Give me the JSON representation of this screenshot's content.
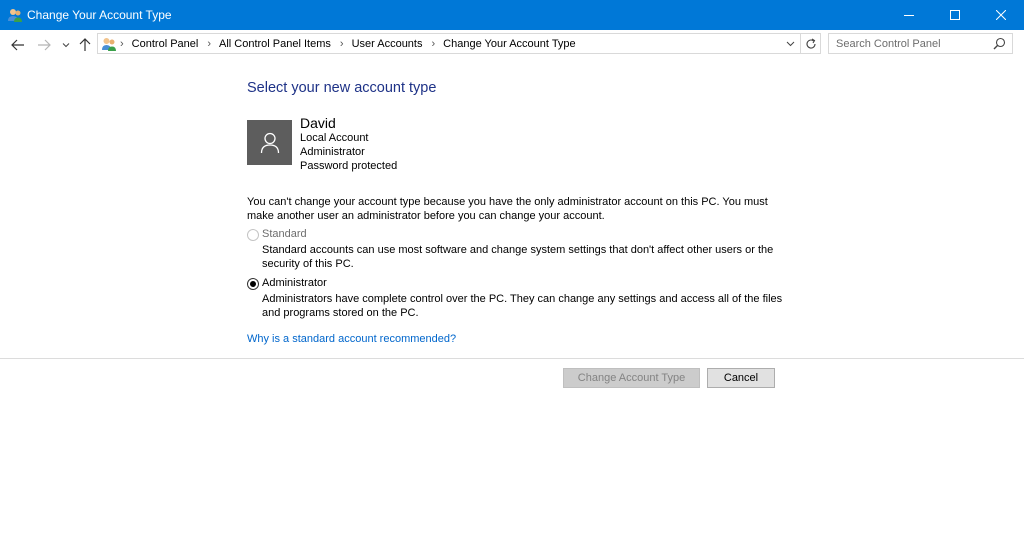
{
  "window": {
    "title": "Change Your Account Type",
    "controls": [
      "minimize-icon",
      "maximize-icon",
      "close-icon"
    ]
  },
  "nav": {
    "back_icon": "arrow-left-icon",
    "forward_icon": "arrow-right-icon",
    "recent_icon": "chevron-down-icon",
    "up_icon": "arrow-up-icon",
    "breadcrumbs": [
      "Control Panel",
      "All Control Panel Items",
      "User Accounts",
      "Change Your Account Type"
    ],
    "refresh_icon": "refresh-icon",
    "search_placeholder": "Search Control Panel"
  },
  "main": {
    "heading": "Select your new account type",
    "user": {
      "name": "David",
      "lines": [
        "Local Account",
        "Administrator",
        "Password protected"
      ]
    },
    "notice": "You can't change your account type because you have the only administrator account on this PC. You must make another user an administrator before you can change your account.",
    "options": [
      {
        "label": "Standard",
        "description": "Standard accounts can use most software and change system settings that don't affect other users or the security of this PC.",
        "selected": false,
        "enabled": false
      },
      {
        "label": "Administrator",
        "description": "Administrators have complete control over the PC. They can change any settings and access all of the files and programs stored on the PC.",
        "selected": true,
        "enabled": true
      }
    ],
    "help_link": "Why is a standard account recommended?"
  },
  "footer": {
    "primary_button": "Change Account Type",
    "cancel_button": "Cancel"
  },
  "colors": {
    "titlebar": "#0078d7",
    "heading": "#1e3287",
    "link": "#0066cc"
  }
}
